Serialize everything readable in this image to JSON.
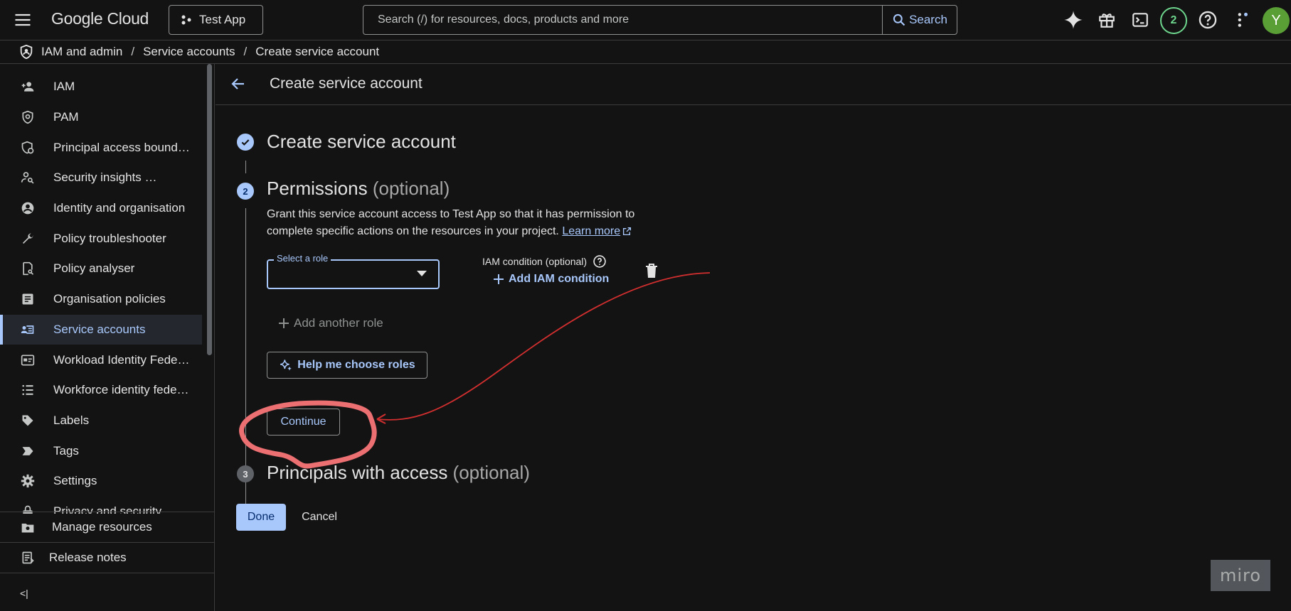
{
  "topbar": {
    "logo": "Google Cloud",
    "project": "Test App",
    "search_placeholder": "Search (/) for resources, docs, products and more",
    "search_button": "Search",
    "notification_count": "2",
    "avatar_initial": "Y"
  },
  "breadcrumb": [
    "IAM and admin",
    "Service accounts",
    "Create service account"
  ],
  "sidebar": {
    "items": [
      {
        "label": "IAM",
        "icon": "add-person-icon"
      },
      {
        "label": "PAM",
        "icon": "shield-icon"
      },
      {
        "label": "Principal access bound…",
        "icon": "shield-gear-icon"
      },
      {
        "label": "Security insights …",
        "icon": "person-search-icon"
      },
      {
        "label": "Identity and organisation",
        "icon": "account-circle-icon"
      },
      {
        "label": "Policy troubleshooter",
        "icon": "wrench-icon"
      },
      {
        "label": "Policy analyser",
        "icon": "document-search-icon"
      },
      {
        "label": "Organisation policies",
        "icon": "article-icon"
      },
      {
        "label": "Service accounts",
        "icon": "service-account-icon",
        "active": true
      },
      {
        "label": "Workload Identity Fede…",
        "icon": "id-card-icon"
      },
      {
        "label": "Workforce identity fede…",
        "icon": "list-icon"
      },
      {
        "label": "Labels",
        "icon": "label-icon"
      },
      {
        "label": "Tags",
        "icon": "tag-arrow-icon"
      },
      {
        "label": "Settings",
        "icon": "gear-icon"
      },
      {
        "label": "Privacy and security",
        "icon": "lock-icon"
      }
    ],
    "bottom": [
      {
        "label": "Manage resources",
        "icon": "manage-resources-icon"
      },
      {
        "label": "Release notes",
        "icon": "release-notes-icon"
      }
    ],
    "collapse": "<|"
  },
  "main": {
    "header_title": "Create service account",
    "step1": {
      "title": "Create service account"
    },
    "step2": {
      "number": "2",
      "title": "Permissions",
      "optional": "(optional)",
      "description": "Grant this service account access to Test App so that it has permission to complete specific actions on the resources in your project.",
      "learn_more": "Learn more",
      "role_label": "Select a role",
      "iam_condition_label": "IAM condition (optional)",
      "add_iam_condition": "Add IAM condition",
      "add_another_role": "Add another role",
      "help_button": "Help me choose roles",
      "continue_button": "Continue"
    },
    "step3": {
      "number": "3",
      "title": "Principals with access",
      "optional": "(optional)"
    },
    "done_button": "Done",
    "cancel_button": "Cancel"
  },
  "watermark": "miro",
  "colors": {
    "background": "#131314",
    "accent": "#a8c7fa",
    "annotation_red": "#e8575a",
    "badge_green": "#6dd58c",
    "avatar_green": "#5a9e36"
  }
}
